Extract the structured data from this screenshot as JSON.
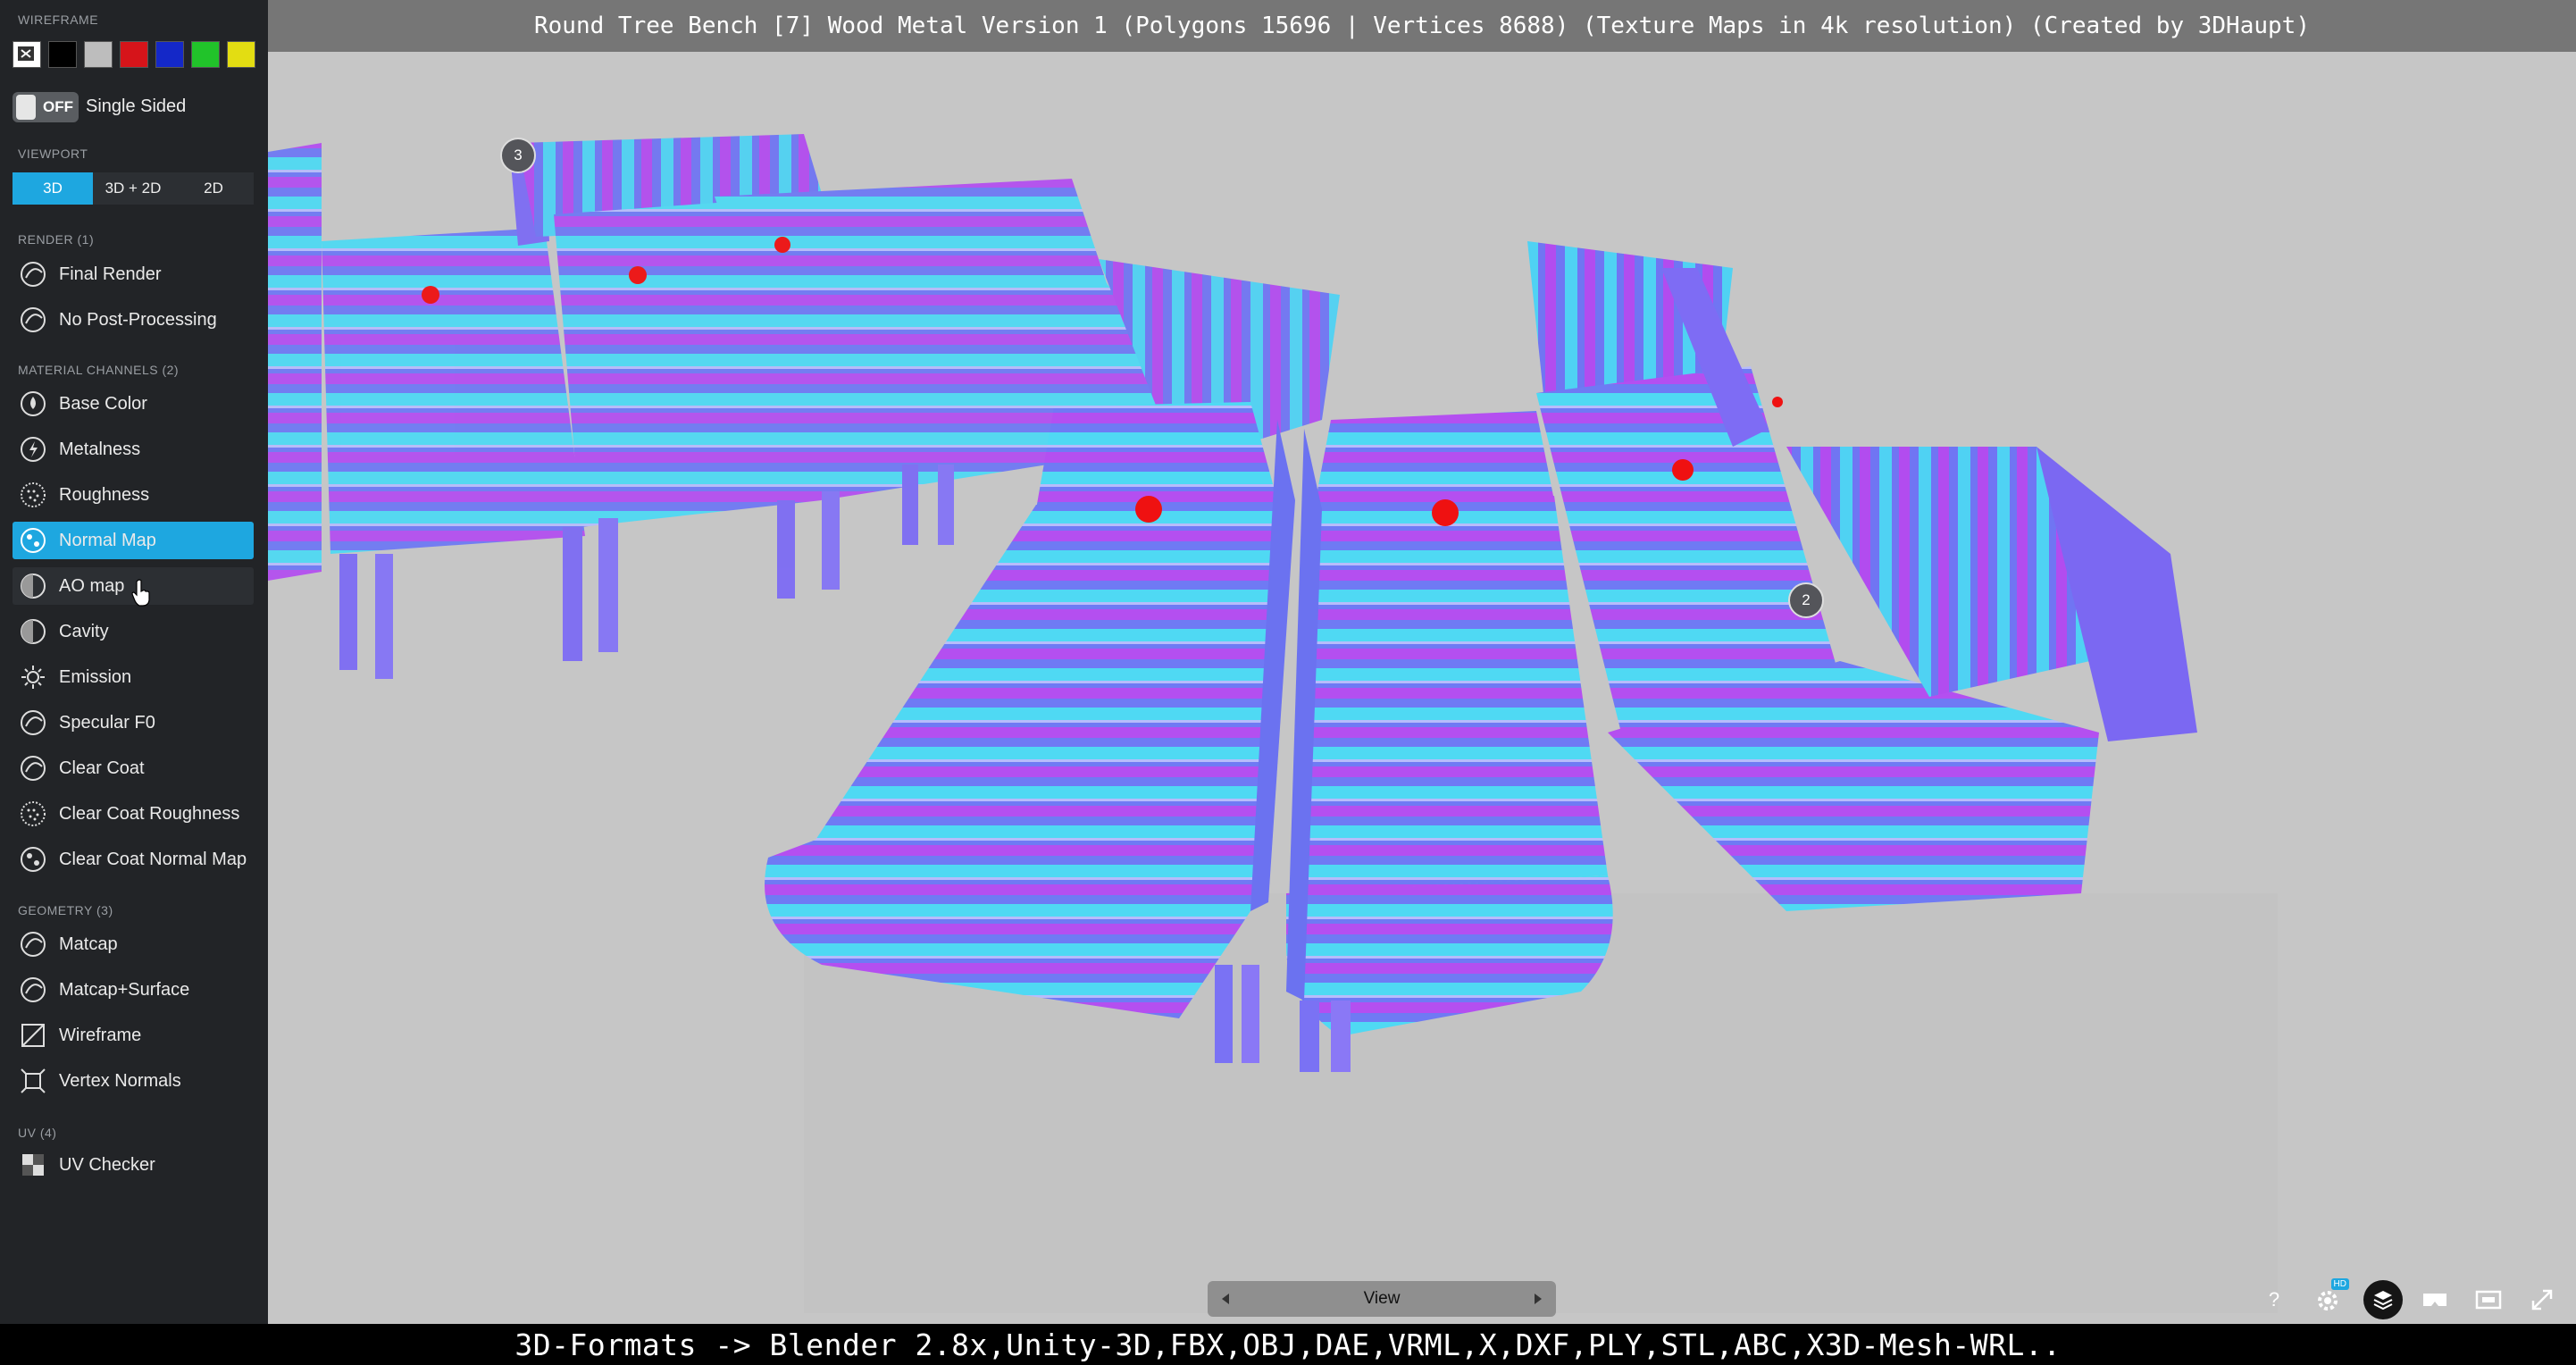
{
  "title_bar": {
    "title": "Round Tree Bench [7] Wood Metal Version 1 (Polygons 15696 | Vertices 8688) (Texture Maps in 4k resolution) (Created by 3DHaupt)"
  },
  "sidebar": {
    "wireframe": {
      "label": "WIREFRAME",
      "swatches": [
        "#222222",
        "#000000",
        "#bdbdbd",
        "#d6141a",
        "#1428c8",
        "#21c32a",
        "#e3dd12"
      ]
    },
    "single_sided": {
      "toggle_state": "OFF",
      "label": "Single Sided"
    },
    "viewport": {
      "label": "VIEWPORT",
      "options": [
        "3D",
        "3D + 2D",
        "2D"
      ],
      "selected": "3D"
    },
    "render": {
      "label": "RENDER (1)",
      "items": [
        {
          "label": "Final Render",
          "icon": "sphere-icon"
        },
        {
          "label": "No Post-Processing",
          "icon": "sphere-icon"
        }
      ]
    },
    "material_channels": {
      "label": "MATERIAL CHANNELS (2)",
      "items": [
        {
          "label": "Base Color",
          "icon": "drop-icon"
        },
        {
          "label": "Metalness",
          "icon": "metal-icon"
        },
        {
          "label": "Roughness",
          "icon": "dots-sphere-icon"
        },
        {
          "label": "Normal Map",
          "icon": "normal-sphere-icon",
          "active": true
        },
        {
          "label": "AO map",
          "icon": "half-sphere-icon",
          "hover": true
        },
        {
          "label": "Cavity",
          "icon": "half-sphere-icon"
        },
        {
          "label": "Emission",
          "icon": "sun-icon"
        },
        {
          "label": "Specular F0",
          "icon": "sphere-icon"
        },
        {
          "label": "Clear Coat",
          "icon": "sphere-icon"
        },
        {
          "label": "Clear Coat Roughness",
          "icon": "dots-sphere-icon"
        },
        {
          "label": "Clear Coat Normal Map",
          "icon": "normal-sphere-icon"
        }
      ]
    },
    "geometry": {
      "label": "GEOMETRY (3)",
      "items": [
        {
          "label": "Matcap",
          "icon": "sphere-icon"
        },
        {
          "label": "Matcap+Surface",
          "icon": "sphere-icon"
        },
        {
          "label": "Wireframe",
          "icon": "wireframe-icon"
        },
        {
          "label": "Vertex Normals",
          "icon": "vertex-normals-icon"
        }
      ]
    },
    "uv": {
      "label": "UV (4)",
      "items": [
        {
          "label": "UV Checker",
          "icon": "checker-icon"
        }
      ]
    }
  },
  "viewport": {
    "hotspots": [
      "3",
      "2"
    ],
    "nav": {
      "label": "View"
    },
    "bottom_icons": [
      "help-icon",
      "settings-hd-icon",
      "layers-icon",
      "vr-icon",
      "embed-icon",
      "fullscreen-icon"
    ],
    "hd_badge": "HD",
    "help_label": "?"
  },
  "footer": {
    "formats": "3D-Formats -> Blender 2.8x,Unity-3D,FBX,OBJ,DAE,VRML,X,DXF,PLY,STL,ABC,X3D-Mesh-WRL.."
  }
}
